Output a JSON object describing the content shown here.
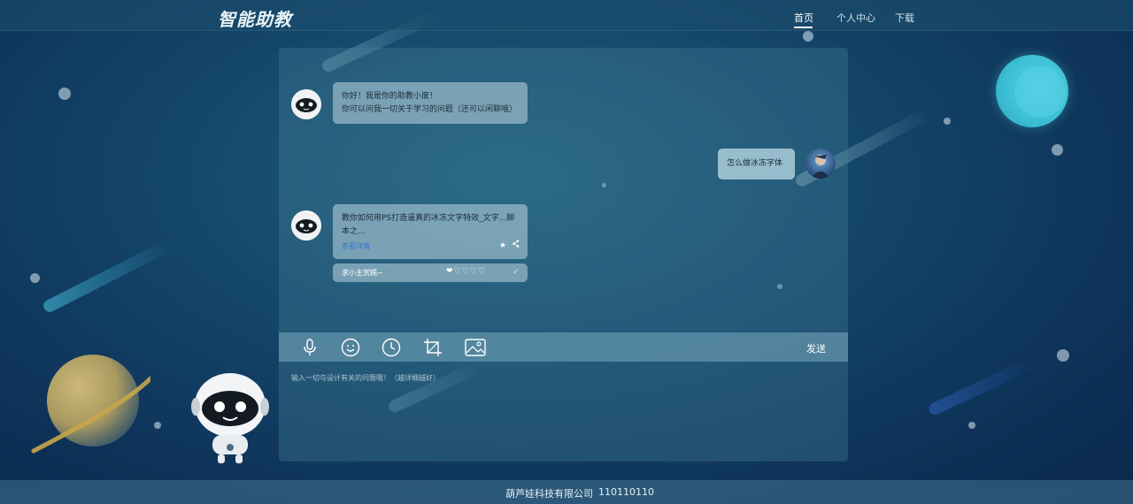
{
  "header": {
    "logo": "智能助教",
    "nav": [
      "首页",
      "个人中心",
      "下载"
    ]
  },
  "chat": {
    "messages": [
      {
        "from": "bot",
        "lines": [
          "你好！我是你的助教小度！",
          "你可以问我一切关于学习的问题（还可以闲聊哦）"
        ]
      },
      {
        "from": "user",
        "text": "怎么做冰冻字体"
      },
      {
        "from": "bot",
        "text": "教你如何用PS打造逼真的冰冻文字特效_文字...脚本之...",
        "link": "查看详情"
      },
      {
        "from": "bot",
        "rating_text": "求小主赏赐~"
      }
    ],
    "send_label": "发送",
    "input_placeholder": "输入一切与设计有关的问题哦！（越详细越好）"
  },
  "footer": {
    "company": "葫芦娃科技有限公司",
    "number": "110110110"
  },
  "colors": {
    "background": "#14456a",
    "accent": "#3a78c9",
    "planet_teal": "#4fc9dc"
  },
  "icons": [
    "microphone-icon",
    "emoji-icon",
    "clock-icon",
    "crop-icon",
    "image-icon",
    "star-icon",
    "share-icon",
    "heart-icon",
    "check-icon"
  ]
}
